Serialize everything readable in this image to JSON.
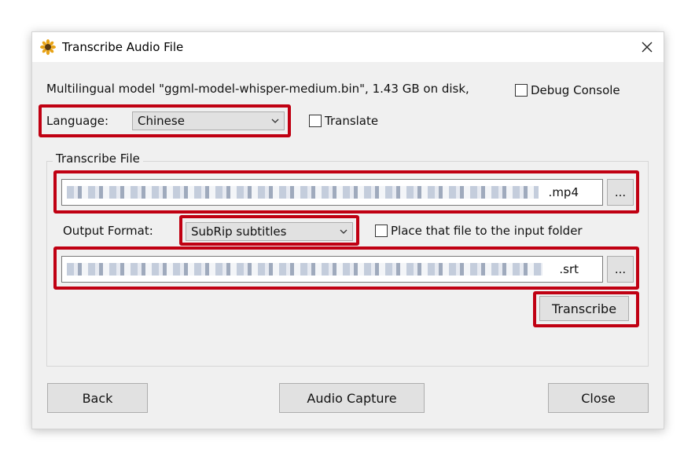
{
  "window": {
    "title": "Transcribe Audio File"
  },
  "model_info": "Multilingual model \"ggml-model-whisper-medium.bin\", 1.43 GB on disk,",
  "debug_console": {
    "label": "Debug Console",
    "checked": false
  },
  "language": {
    "label": "Language:",
    "selected": "Chinese"
  },
  "translate": {
    "label": "Translate",
    "checked": false
  },
  "transcribe_file": {
    "group_title": "Transcribe File",
    "input_suffix": ".mp4",
    "browse_label": "..."
  },
  "output": {
    "format_label": "Output Format:",
    "format_selected": "SubRip subtitles",
    "place_label": "Place that file to the input folder",
    "place_checked": false,
    "path_suffix": ".srt",
    "browse_label": "..."
  },
  "buttons": {
    "transcribe": "Transcribe",
    "back": "Back",
    "audio_capture": "Audio Capture",
    "close": "Close"
  },
  "colors": {
    "highlight": "#c00012",
    "window_bg": "#f0f0f0",
    "button_bg": "#e1e1e1"
  }
}
